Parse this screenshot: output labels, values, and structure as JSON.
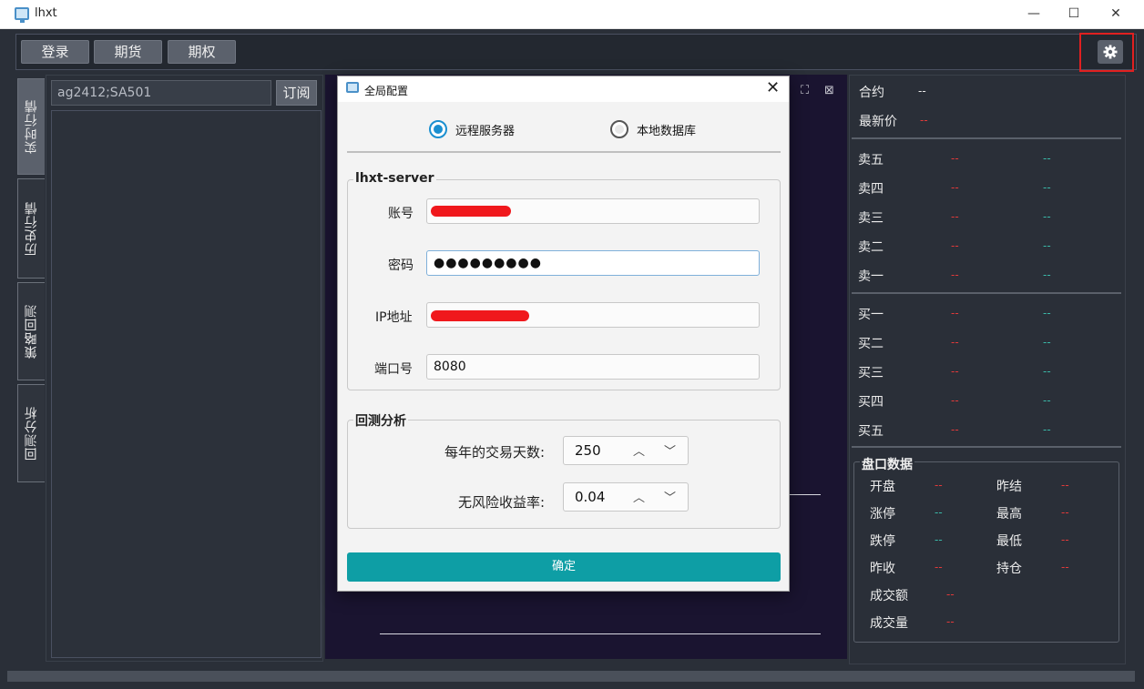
{
  "window": {
    "title": "lhxt",
    "min_glyph": "—",
    "max_glyph": "☐",
    "close_glyph": "✕"
  },
  "toolbar": {
    "login": "登录",
    "futures": "期货",
    "options": "期权",
    "settings_icon": "gear-icon"
  },
  "tabs": [
    {
      "label": "实时行情",
      "active": true
    },
    {
      "label": "历史行情",
      "active": false
    },
    {
      "label": "策略回测",
      "active": false
    },
    {
      "label": "回测分析",
      "active": false
    }
  ],
  "left_panel": {
    "symbols_value": "ag2412;SA501",
    "subscribe": "订阅"
  },
  "quote": {
    "contract_label": "合约",
    "contract_value": "--",
    "last_label": "最新价",
    "last_value": "--",
    "asks": [
      {
        "label": "卖五",
        "price": "--",
        "volume": "--"
      },
      {
        "label": "卖四",
        "price": "--",
        "volume": "--"
      },
      {
        "label": "卖三",
        "price": "--",
        "volume": "--"
      },
      {
        "label": "卖二",
        "price": "--",
        "volume": "--"
      },
      {
        "label": "卖一",
        "price": "--",
        "volume": "--"
      }
    ],
    "bids": [
      {
        "label": "买一",
        "price": "--",
        "volume": "--"
      },
      {
        "label": "买二",
        "price": "--",
        "volume": "--"
      },
      {
        "label": "买三",
        "price": "--",
        "volume": "--"
      },
      {
        "label": "买四",
        "price": "--",
        "volume": "--"
      },
      {
        "label": "买五",
        "price": "--",
        "volume": "--"
      }
    ],
    "panel_title": "盘口数据",
    "panel": {
      "open_label": "开盘",
      "open_value": "--",
      "prev_settle_label": "昨结",
      "prev_settle_value": "--",
      "limit_up_label": "涨停",
      "limit_up_value": "--",
      "high_label": "最高",
      "high_value": "--",
      "limit_down_label": "跌停",
      "limit_down_value": "--",
      "low_label": "最低",
      "low_value": "--",
      "prev_close_label": "昨收",
      "prev_close_value": "--",
      "open_interest_label": "持仓",
      "open_interest_value": "--",
      "turnover_label": "成交额",
      "turnover_value": "--",
      "volume_label": "成交量",
      "volume_value": "--"
    }
  },
  "dialog": {
    "title": "全局配置",
    "close_glyph": "✕",
    "radio_remote": "远程服务器",
    "radio_local": "本地数据库",
    "selected": "远程服务器",
    "server_group_title": "lhxt-server",
    "account_label": "账号",
    "password_label": "密码",
    "password_value": "●●●●●●●●●",
    "ip_label": "IP地址",
    "port_label": "端口号",
    "port_value": "8080",
    "backtest_group_title": "回测分析",
    "trading_days_label": "每年的交易天数:",
    "trading_days_value": "250",
    "risk_free_label": "无风险收益率:",
    "risk_free_value": "0.04",
    "ok": "确定"
  },
  "colors": {
    "accent": "#0e9ea5",
    "radio": "#1a8fd0",
    "down": "#e03a3a",
    "up": "#3ab8a8",
    "highlight": "#e02020"
  }
}
